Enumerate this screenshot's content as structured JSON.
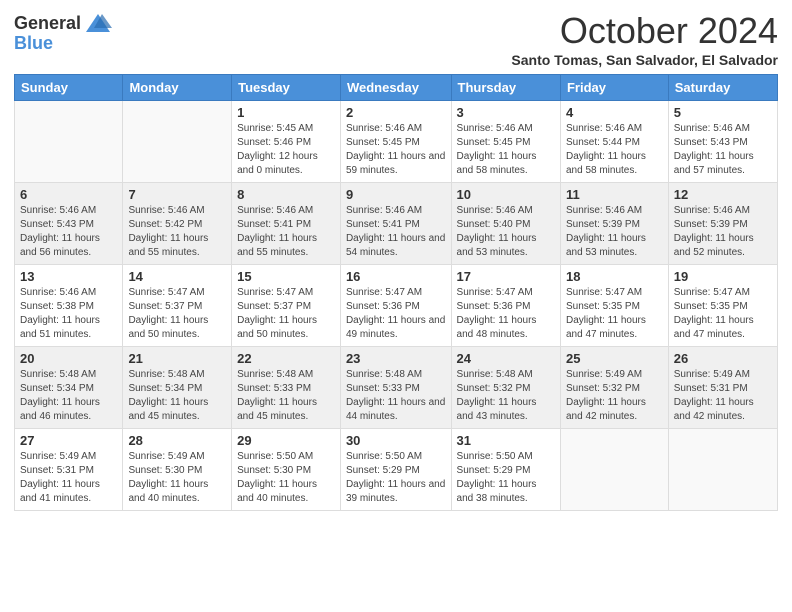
{
  "logo": {
    "text_general": "General",
    "text_blue": "Blue"
  },
  "header": {
    "title": "October 2024",
    "subtitle": "Santo Tomas, San Salvador, El Salvador"
  },
  "days_of_week": [
    "Sunday",
    "Monday",
    "Tuesday",
    "Wednesday",
    "Thursday",
    "Friday",
    "Saturday"
  ],
  "weeks": [
    [
      {
        "day": "",
        "info": ""
      },
      {
        "day": "",
        "info": ""
      },
      {
        "day": "1",
        "info": "Sunrise: 5:45 AM\nSunset: 5:46 PM\nDaylight: 12 hours and 0 minutes."
      },
      {
        "day": "2",
        "info": "Sunrise: 5:46 AM\nSunset: 5:45 PM\nDaylight: 11 hours and 59 minutes."
      },
      {
        "day": "3",
        "info": "Sunrise: 5:46 AM\nSunset: 5:45 PM\nDaylight: 11 hours and 58 minutes."
      },
      {
        "day": "4",
        "info": "Sunrise: 5:46 AM\nSunset: 5:44 PM\nDaylight: 11 hours and 58 minutes."
      },
      {
        "day": "5",
        "info": "Sunrise: 5:46 AM\nSunset: 5:43 PM\nDaylight: 11 hours and 57 minutes."
      }
    ],
    [
      {
        "day": "6",
        "info": "Sunrise: 5:46 AM\nSunset: 5:43 PM\nDaylight: 11 hours and 56 minutes."
      },
      {
        "day": "7",
        "info": "Sunrise: 5:46 AM\nSunset: 5:42 PM\nDaylight: 11 hours and 55 minutes."
      },
      {
        "day": "8",
        "info": "Sunrise: 5:46 AM\nSunset: 5:41 PM\nDaylight: 11 hours and 55 minutes."
      },
      {
        "day": "9",
        "info": "Sunrise: 5:46 AM\nSunset: 5:41 PM\nDaylight: 11 hours and 54 minutes."
      },
      {
        "day": "10",
        "info": "Sunrise: 5:46 AM\nSunset: 5:40 PM\nDaylight: 11 hours and 53 minutes."
      },
      {
        "day": "11",
        "info": "Sunrise: 5:46 AM\nSunset: 5:39 PM\nDaylight: 11 hours and 53 minutes."
      },
      {
        "day": "12",
        "info": "Sunrise: 5:46 AM\nSunset: 5:39 PM\nDaylight: 11 hours and 52 minutes."
      }
    ],
    [
      {
        "day": "13",
        "info": "Sunrise: 5:46 AM\nSunset: 5:38 PM\nDaylight: 11 hours and 51 minutes."
      },
      {
        "day": "14",
        "info": "Sunrise: 5:47 AM\nSunset: 5:37 PM\nDaylight: 11 hours and 50 minutes."
      },
      {
        "day": "15",
        "info": "Sunrise: 5:47 AM\nSunset: 5:37 PM\nDaylight: 11 hours and 50 minutes."
      },
      {
        "day": "16",
        "info": "Sunrise: 5:47 AM\nSunset: 5:36 PM\nDaylight: 11 hours and 49 minutes."
      },
      {
        "day": "17",
        "info": "Sunrise: 5:47 AM\nSunset: 5:36 PM\nDaylight: 11 hours and 48 minutes."
      },
      {
        "day": "18",
        "info": "Sunrise: 5:47 AM\nSunset: 5:35 PM\nDaylight: 11 hours and 47 minutes."
      },
      {
        "day": "19",
        "info": "Sunrise: 5:47 AM\nSunset: 5:35 PM\nDaylight: 11 hours and 47 minutes."
      }
    ],
    [
      {
        "day": "20",
        "info": "Sunrise: 5:48 AM\nSunset: 5:34 PM\nDaylight: 11 hours and 46 minutes."
      },
      {
        "day": "21",
        "info": "Sunrise: 5:48 AM\nSunset: 5:34 PM\nDaylight: 11 hours and 45 minutes."
      },
      {
        "day": "22",
        "info": "Sunrise: 5:48 AM\nSunset: 5:33 PM\nDaylight: 11 hours and 45 minutes."
      },
      {
        "day": "23",
        "info": "Sunrise: 5:48 AM\nSunset: 5:33 PM\nDaylight: 11 hours and 44 minutes."
      },
      {
        "day": "24",
        "info": "Sunrise: 5:48 AM\nSunset: 5:32 PM\nDaylight: 11 hours and 43 minutes."
      },
      {
        "day": "25",
        "info": "Sunrise: 5:49 AM\nSunset: 5:32 PM\nDaylight: 11 hours and 42 minutes."
      },
      {
        "day": "26",
        "info": "Sunrise: 5:49 AM\nSunset: 5:31 PM\nDaylight: 11 hours and 42 minutes."
      }
    ],
    [
      {
        "day": "27",
        "info": "Sunrise: 5:49 AM\nSunset: 5:31 PM\nDaylight: 11 hours and 41 minutes."
      },
      {
        "day": "28",
        "info": "Sunrise: 5:49 AM\nSunset: 5:30 PM\nDaylight: 11 hours and 40 minutes."
      },
      {
        "day": "29",
        "info": "Sunrise: 5:50 AM\nSunset: 5:30 PM\nDaylight: 11 hours and 40 minutes."
      },
      {
        "day": "30",
        "info": "Sunrise: 5:50 AM\nSunset: 5:29 PM\nDaylight: 11 hours and 39 minutes."
      },
      {
        "day": "31",
        "info": "Sunrise: 5:50 AM\nSunset: 5:29 PM\nDaylight: 11 hours and 38 minutes."
      },
      {
        "day": "",
        "info": ""
      },
      {
        "day": "",
        "info": ""
      }
    ]
  ]
}
